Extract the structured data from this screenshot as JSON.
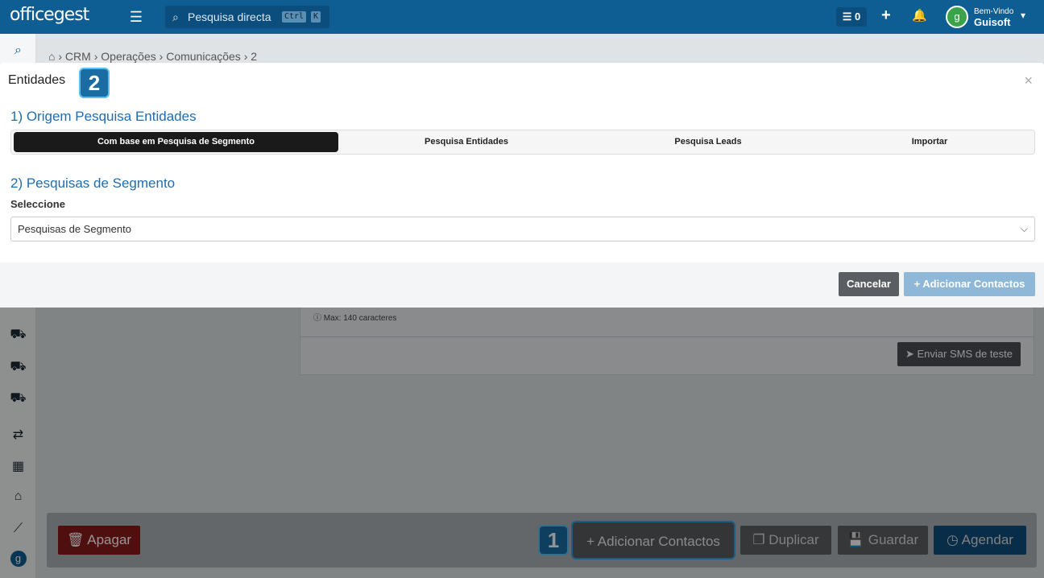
{
  "app": {
    "logo": "officegest"
  },
  "topbar": {
    "search_placeholder": "Pesquisa directa",
    "shortcut_ctrl": "Ctrl",
    "shortcut_key": "K",
    "tasks_count": "0",
    "welcome": "Bem-Vindo",
    "username": "Guisoft"
  },
  "breadcrumb": [
    "CRM",
    "Operações",
    "Comunicações",
    "2"
  ],
  "modal": {
    "title": "Entidades",
    "section1": "1) Origem Pesquisa Entidades",
    "tabs": [
      "Com base em Pesquisa de Segmento",
      "Pesquisa Entidades",
      "Pesquisa Leads",
      "Importar"
    ],
    "active_tab": "Com base em Pesquisa de Segmento",
    "section2": "2) Pesquisas de Segmento",
    "select_label": "Seleccione",
    "select_value": "Pesquisas de Segmento",
    "cancel": "Cancelar",
    "add": "+ Adicionar Contactos"
  },
  "background_card": {
    "max_note": "Max: 140 caracteres",
    "sms_test": "Enviar SMS de teste"
  },
  "footer": {
    "delete": "Apagar",
    "add_contacts": "+ Adicionar Contactos",
    "duplicate": "Duplicar",
    "save": "Guardar",
    "schedule": "Agendar"
  },
  "callouts": {
    "first": "1",
    "second": "2"
  },
  "colors": {
    "topbar": "#0e5d93",
    "accent_blue": "#1e6db1",
    "callout": "#1a6da3",
    "danger": "#8b1a1a"
  }
}
